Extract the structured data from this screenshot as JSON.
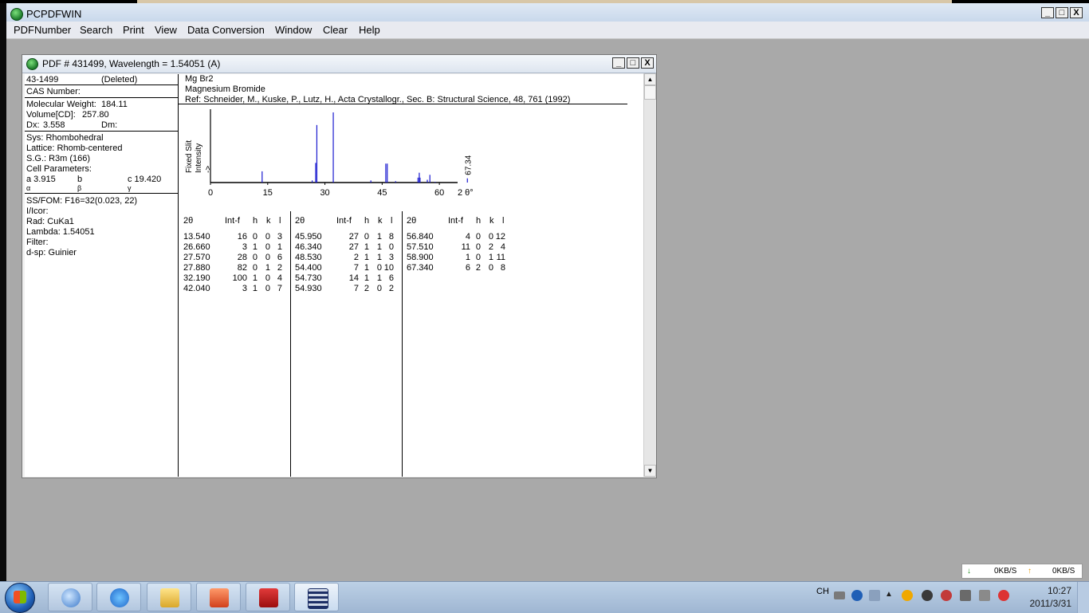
{
  "app": {
    "title": "PCPDFWIN",
    "menu": [
      "PDFNumber",
      "Search",
      "Print",
      "View",
      "Data Conversion",
      "Window",
      "Clear",
      "Help"
    ]
  },
  "window_buttons": {
    "minimize": "_",
    "maximize": "□",
    "close": "X"
  },
  "child": {
    "title": "PDF # 431499,  Wavelength = 1.54051    (A)"
  },
  "card": {
    "id": "43-1499",
    "status": "(Deleted)",
    "cas_label": "CAS Number:",
    "mw_label": "Molecular Weight:",
    "mw_value": "184.11",
    "volume_label": "Volume[CD]:",
    "volume_value": "257.80",
    "dx_label": "Dx:",
    "dx_value": "3.558",
    "dm_label": "Dm:",
    "sys": "Sys: Rhombohedral",
    "lattice": "Lattice: Rhomb-centered",
    "sg": "S.G.: R3m (166)",
    "cell_label": "Cell Parameters:",
    "a": "a  3.915",
    "b": "b",
    "c": "c  19.420",
    "alpha": "α",
    "beta": "β",
    "gamma": "γ",
    "ssfom": "SS/FOM: F16=32(0.023, 22)",
    "icor": "I/Icor:",
    "rad": "Rad: CuKa1",
    "lambda": "Lambda: 1.54051",
    "filter": "Filter:",
    "dsp": "d-sp: Guinier"
  },
  "header": {
    "formula": "Mg Br2",
    "name": "Magnesium Bromide",
    "ref": "Ref: Schneider, M., Kuske, P., Lutz, H., Acta Crystallogr., Sec. B: Structural Science, 48, 761 (1992)"
  },
  "chart_data": {
    "type": "bar",
    "ylabel_lines": [
      "Fixed   Slit",
      "Intensity",
      "->"
    ],
    "xlabel": "2 θ°",
    "x_ticks": [
      "0",
      "15",
      "30",
      "45",
      "60"
    ],
    "xlim": [
      0,
      70
    ],
    "ylim": [
      0,
      100
    ],
    "annotation": "67.34",
    "x": [
      13.54,
      26.66,
      27.57,
      27.88,
      32.19,
      42.04,
      45.95,
      46.34,
      48.53,
      54.4,
      54.73,
      54.93,
      56.84,
      57.51,
      58.9,
      67.34
    ],
    "values": [
      16,
      3,
      28,
      82,
      100,
      3,
      27,
      27,
      2,
      7,
      14,
      7,
      4,
      11,
      1,
      6
    ]
  },
  "table": {
    "headers": [
      "2θ",
      "Int-f",
      "h",
      "k",
      "l"
    ],
    "columns": [
      [
        [
          "13.540",
          "16",
          "0",
          "0",
          "3"
        ],
        [
          "26.660",
          "3",
          "1",
          "0",
          "1"
        ],
        [
          "27.570",
          "28",
          "0",
          "0",
          "6"
        ],
        [
          "27.880",
          "82",
          "0",
          "1",
          "2"
        ],
        [
          "32.190",
          "100",
          "1",
          "0",
          "4"
        ],
        [
          "42.040",
          "3",
          "1",
          "0",
          "7"
        ]
      ],
      [
        [
          "45.950",
          "27",
          "0",
          "1",
          "8"
        ],
        [
          "46.340",
          "27",
          "1",
          "1",
          "0"
        ],
        [
          "48.530",
          "2",
          "1",
          "1",
          "3"
        ],
        [
          "54.400",
          "7",
          "1",
          "0",
          "10"
        ],
        [
          "54.730",
          "14",
          "1",
          "1",
          "6"
        ],
        [
          "54.930",
          "7",
          "2",
          "0",
          "2"
        ]
      ],
      [
        [
          "56.840",
          "4",
          "0",
          "0",
          "12"
        ],
        [
          "57.510",
          "11",
          "0",
          "2",
          "4"
        ],
        [
          "58.900",
          "1",
          "0",
          "1",
          "11"
        ],
        [
          "67.340",
          "6",
          "2",
          "0",
          "8"
        ]
      ]
    ]
  },
  "netspeed": {
    "down": "0KB/S",
    "up": "0KB/S"
  },
  "tray": {
    "lang": "CH"
  },
  "clock": {
    "time": "10:27",
    "date": "2011/3/31"
  },
  "colors": {
    "peak": "#1a1ad0",
    "desktop": "#a9a9a9"
  }
}
